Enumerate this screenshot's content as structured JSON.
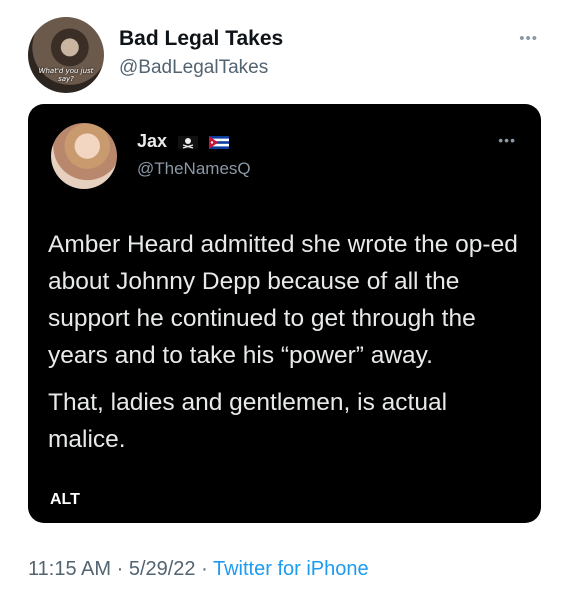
{
  "author": {
    "name": "Bad Legal Takes",
    "handle": "@BadLegalTakes",
    "avatar_caption": "What'd you just say?"
  },
  "more_icon": "more-horizontal-icon",
  "media": {
    "alt_label": "ALT",
    "quoted": {
      "name": "Jax",
      "flags": [
        "pirate-flag-icon",
        "cuba-flag-icon"
      ],
      "handle": "@TheNamesQ",
      "paragraphs": [
        "Amber Heard admitted she wrote the op-ed about Johnny Depp because of all the support he continued to get through the years and to take his “power” away.",
        "That, ladies and gentlemen, is actual malice."
      ]
    }
  },
  "meta": {
    "time": "11:15 AM",
    "sep1": "·",
    "date": "5/29/22",
    "sep2": "·",
    "source": "Twitter for iPhone"
  },
  "colors": {
    "link": "#1d9bf0",
    "secondary_text": "#536471",
    "media_background": "#000000"
  }
}
